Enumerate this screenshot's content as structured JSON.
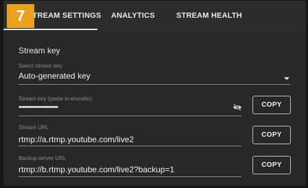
{
  "callout": {
    "number": "7"
  },
  "tabs": [
    {
      "label": "STREAM SETTINGS",
      "active": true
    },
    {
      "label": "ANALYTICS",
      "active": false
    },
    {
      "label": "STREAM HEALTH",
      "active": false
    }
  ],
  "stream_key": {
    "section_title": "Stream key",
    "select_label": "Select stream key",
    "select_value": "Auto-generated key",
    "key_label": "Stream key (paste in encoder)",
    "key_value": "••••••••••••••••••••",
    "copy_label": "COPY"
  },
  "stream_url": {
    "label": "Stream URL",
    "value": "rtmp://a.rtmp.youtube.com/live2",
    "copy_label": "COPY"
  },
  "backup_url": {
    "label": "Backup server URL",
    "value": "rtmp://b.rtmp.youtube.com/live2?backup=1",
    "copy_label": "COPY"
  },
  "colors": {
    "callout": "#e8a21e",
    "panel": "#272727",
    "background": "#161616"
  },
  "icons": {
    "dropdown": "chevron-down-icon",
    "visibility": "eye-off-icon"
  }
}
